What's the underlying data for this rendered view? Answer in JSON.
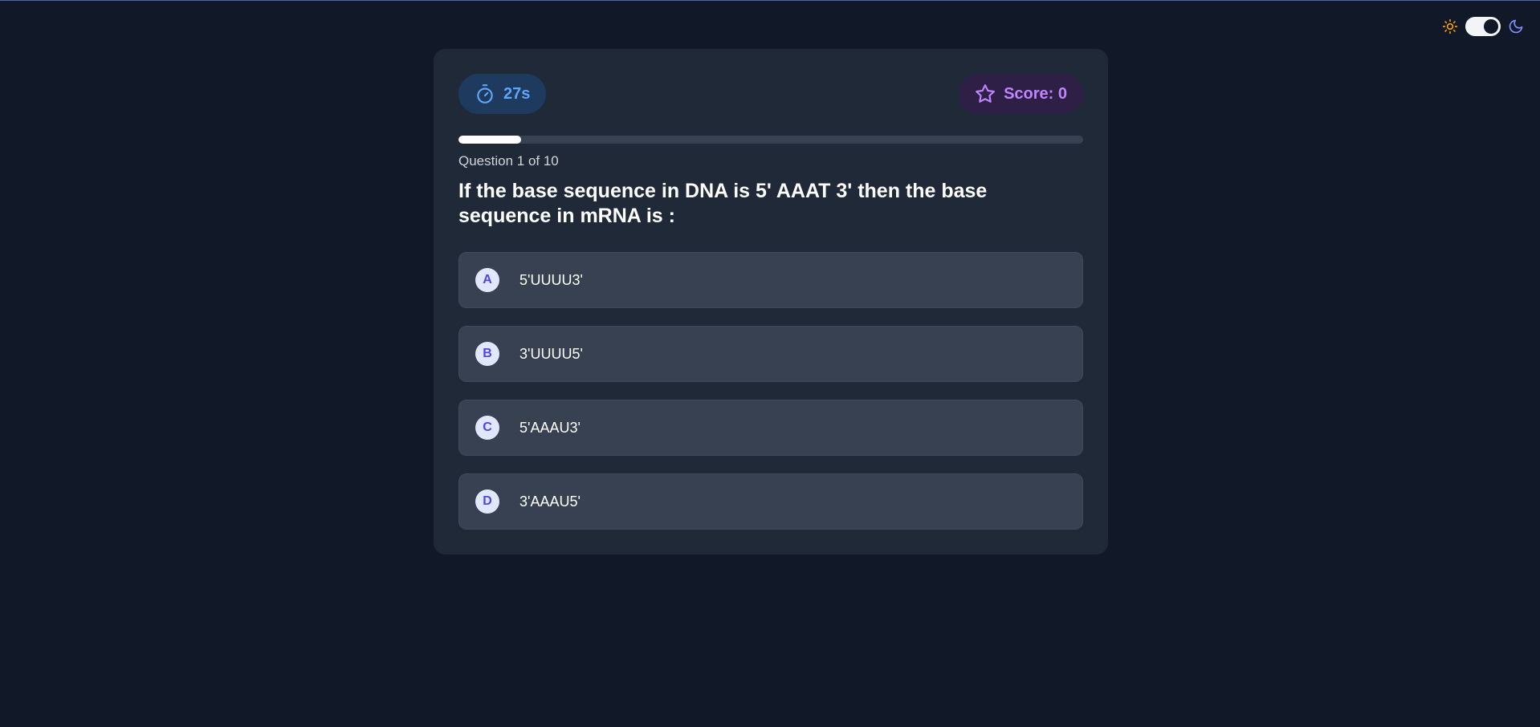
{
  "theme": {
    "sun_icon": "sun-icon",
    "moon_icon": "moon-icon",
    "dark_mode": true
  },
  "header": {
    "timer": "27s",
    "timer_icon": "stopwatch-icon",
    "score": "Score: 0",
    "score_icon": "star-icon"
  },
  "progress": {
    "fraction": 0.1
  },
  "question": {
    "counter": "Question 1 of 10",
    "text": "If the base sequence in DNA is 5' AAAT 3' then the base sequence in mRNA is :"
  },
  "options": [
    {
      "letter": "A",
      "text": "5'UUUU3'"
    },
    {
      "letter": "B",
      "text": "3'UUUU5'"
    },
    {
      "letter": "C",
      "text": "5'AAAU3'"
    },
    {
      "letter": "D",
      "text": "3'AAAU5'"
    }
  ],
  "colors": {
    "background": "#111827",
    "card": "#1f2937",
    "option": "#374151",
    "timer_accent": "#60a5fa",
    "score_accent": "#c084fc",
    "letter_accent": "#4f46e5",
    "sun": "#f59e0b",
    "moon": "#818cf8"
  }
}
